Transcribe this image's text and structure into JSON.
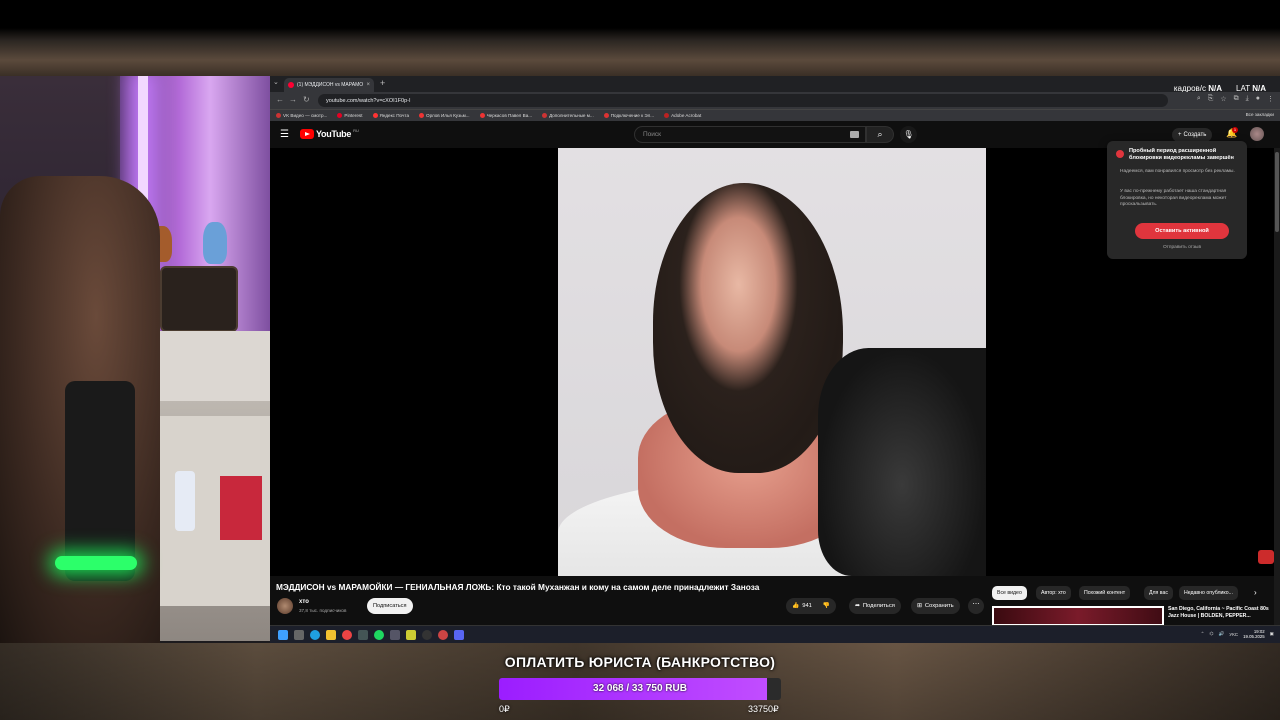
{
  "browser": {
    "tab_title": "(1) МЭДДИСОН vs МАРАМОЙКИ",
    "url": "youtube.com/watch?v=cXOI1F0p-I",
    "overlay": {
      "fps_label": "кадров/с",
      "fps_value": "N/A",
      "lat_label": "LAT",
      "lat_value": "N/A"
    },
    "bookmarks": [
      "VK Видео — смотр...",
      "Pinterest",
      "Яндекс Почта",
      "Орлов Илья Кузьм...",
      "Черкасов Павел Ва...",
      "Дополнительные м...",
      "Подключение к Эл...",
      "Adobe Acrobat"
    ],
    "bookmarks_all": "Все закладки"
  },
  "youtube": {
    "logo_text": "YouTube",
    "country": "RU",
    "search_placeholder": "Поиск",
    "create_label": "Создать",
    "notif_count": "1",
    "video_title": "МЭДДИСОН vs МАРАМОЙКИ — ГЕНИАЛЬНАЯ ЛОЖЬ: Кто такой Муханжан и кому на самом деле принадлежит Заноза",
    "channel_name": "хто",
    "channel_subs": "37,8 тыс. подписчиков",
    "subscribe_label": "Подписаться",
    "likes": "941",
    "share_label": "Поделиться",
    "save_label": "Сохранить",
    "chips": [
      "Все видео",
      "Автор: хто",
      "Похожий контент",
      "Для вас",
      "Недавно опублико..."
    ],
    "rec_title": "San Diego, California ~ Pacific Coast 80s Jazz House | BOLDEN, PEPPER...",
    "popup": {
      "title": "Пробный период расширенной блокировки видеорекламы завершён",
      "p1": "Надеемся, вам понравился просмотр без рекламы.",
      "p2": "У вас по-прежнему работает наша стандартная блокировка, но некоторая видеореклама может проскальзывать.",
      "button": "Оставить активной",
      "link": "Отправить отзыв"
    }
  },
  "taskbar": {
    "lang": "УКС",
    "time": "19:02",
    "date": "19.05.2025"
  },
  "donation": {
    "title": "ОПЛАТИТЬ ЮРИСТА (БАНКРОТСТВО)",
    "amount_text": "32 068 / 33 750 RUB",
    "progress": 0.9502,
    "min_label": "0₽",
    "max_label": "33750₽",
    "fill_color": "#a42bff"
  }
}
